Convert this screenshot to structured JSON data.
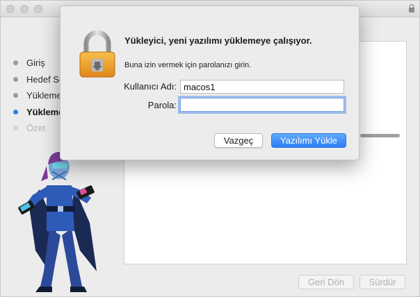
{
  "background_window": {
    "steps": [
      {
        "label": "Giriş",
        "state": "done"
      },
      {
        "label": "Hedef Seçimi",
        "state": "done"
      },
      {
        "label": "Yükleme Türü",
        "state": "done"
      },
      {
        "label": "Yükleme",
        "state": "active"
      },
      {
        "label": "Özet",
        "state": "disabled"
      }
    ],
    "back_label": "Geri Dön",
    "continue_label": "Sürdür"
  },
  "dialog": {
    "title": "Yükleyici, yeni yazılımı yüklemeye çalışıyor.",
    "subtitle": "Buna izin vermek için parolanızı girin.",
    "username_label": "Kullanıcı Adı:",
    "username_value": "macos1",
    "password_label": "Parola:",
    "password_value": "",
    "cancel_label": "Vazgeç",
    "install_label": "Yazılımı Yükle",
    "icon": "lock-icon"
  },
  "colors": {
    "accent": "#2f7ef3",
    "active_step_dot": "#2a82f0",
    "lock_gold": "#f0a52a"
  }
}
